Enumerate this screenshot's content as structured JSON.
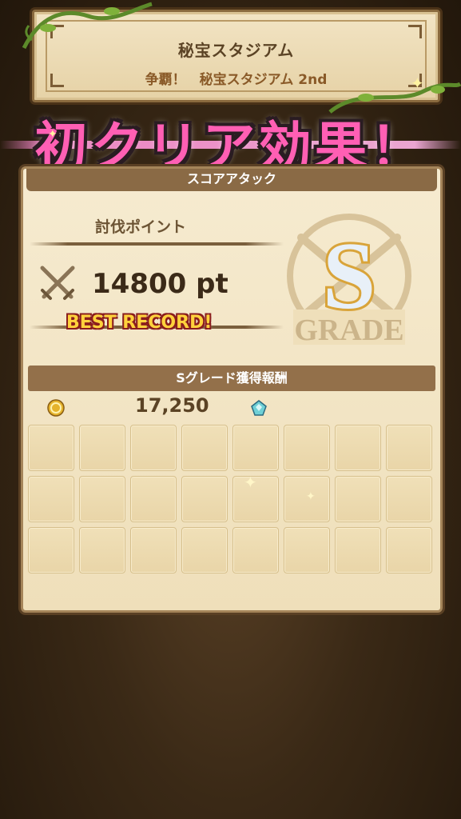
{
  "header": {
    "title": "秘宝スタジアム",
    "subtitle": "争覇！　秘宝スタジアム 2nd"
  },
  "banner": {
    "text": "初クリア効果！"
  },
  "panel": {
    "header_label": "スコアアタック",
    "points_label": "討伐ポイント",
    "score_value": "14800 pt",
    "best_record": "BEST RECORD!",
    "grade_letter": "S",
    "grade_word": "GRADE",
    "reward_title": "Sグレード獲得報酬",
    "rewards": {
      "coin_icon": "gold-coin-icon",
      "coin_value": "17,250",
      "gem_icon": "blue-crystal-icon"
    },
    "slot_rows": 3,
    "slot_columns": 8
  },
  "colors": {
    "banner_pink": "#ff5fb4",
    "panel_bg": "#f6ebd0",
    "header_brown": "#8a6a45",
    "grade_gold": "#d9a43a"
  }
}
